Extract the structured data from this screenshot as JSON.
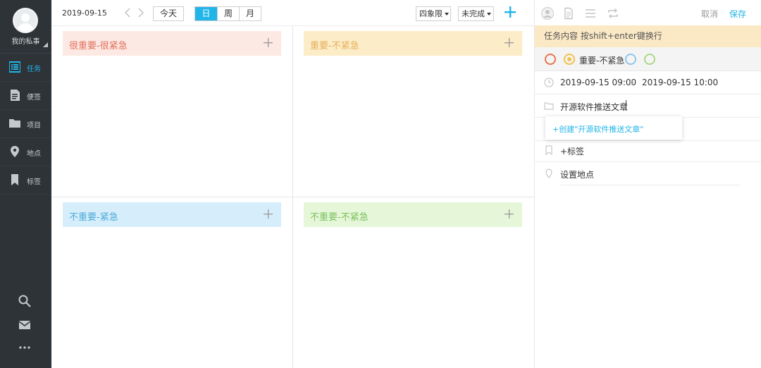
{
  "sidebar": {
    "profile_name": "我的私事",
    "items": [
      {
        "label": "任务",
        "icon": "list-icon",
        "active": true
      },
      {
        "label": "便签",
        "icon": "note-icon",
        "active": false
      },
      {
        "label": "项目",
        "icon": "folder-icon",
        "active": false
      },
      {
        "label": "地点",
        "icon": "location-pin-icon",
        "active": false
      },
      {
        "label": "标签",
        "icon": "bookmark-icon",
        "active": false
      }
    ],
    "bottom_icons": [
      "search-icon",
      "mail-icon",
      "more-dots-icon"
    ]
  },
  "toolbar": {
    "date": "2019-09-15",
    "today_label": "今天",
    "view_tabs": [
      "日",
      "周",
      "月"
    ],
    "active_view": "日",
    "quadrant_select": "四象限",
    "status_select": "未完成",
    "add_icon": "plus-icon"
  },
  "quadrants": [
    {
      "label": "很重要-很紧急",
      "bg": "#fde9e4",
      "fg": "#e2715c"
    },
    {
      "label": "重要-不紧急",
      "bg": "#fdecc8",
      "fg": "#e6b15c"
    },
    {
      "label": "不重要-紧急",
      "bg": "#d6eefb",
      "fg": "#4aa9d8"
    },
    {
      "label": "不重要-不紧急",
      "bg": "#e6f7d9",
      "fg": "#7bbf5b"
    }
  ],
  "panel": {
    "cancel_label": "取消",
    "save_label": "保存",
    "content_placeholder": "任务内容 按shift+enter键换行",
    "priority_label": "重要-不紧急",
    "priority_colors": [
      "#e8764f",
      "#f2c14e",
      "#8fc6ef",
      "#a9d98a"
    ],
    "start_time": "2019-09-15 09:00",
    "end_time": "2019-09-15 10:00",
    "project_value": "开源软件推送文章",
    "create_project_suggestion": "+创建\"开源软件推送文章\"",
    "tag_label": "+标签",
    "location_label": "设置地点"
  },
  "colors": {
    "accent": "#21b5e8",
    "sidebar_bg": "#2e3338"
  }
}
